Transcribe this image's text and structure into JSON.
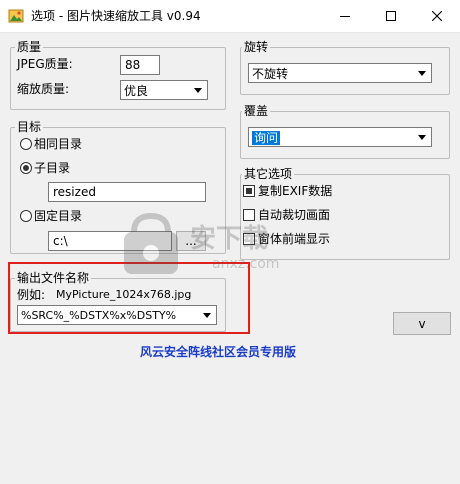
{
  "window": {
    "title": "选项 - 图片快速缩放工具 v0.94"
  },
  "quality": {
    "legend": "质量",
    "jpeg_label": "JPEG质量:",
    "jpeg_value": "88",
    "resample_label": "缩放质量:",
    "resample_value": "优良"
  },
  "target": {
    "legend": "目标",
    "same_dir": "相同目录",
    "sub_dir": "子目录",
    "sub_dir_value": "resized",
    "fixed_dir": "固定目录",
    "fixed_dir_value": "c:\\",
    "browse_label": "..."
  },
  "output": {
    "legend": "输出文件名称",
    "example_label": "例如:",
    "example_value": "MyPicture_1024x768.jpg",
    "pattern_value": "%SRC%_%DSTX%x%DSTY%"
  },
  "rotate": {
    "legend": "旋转",
    "value": "不旋转"
  },
  "overwrite": {
    "legend": "覆盖",
    "value": "询问"
  },
  "other": {
    "legend": "其它选项",
    "copy_exif": "复制EXIF数据",
    "auto_crop": "自动裁切画面",
    "topmost": "窗体前端显示"
  },
  "footer_text": "风云安全阵线社区会员专用版",
  "collapse_button": "v",
  "watermark": {
    "brand": "安下载",
    "domain": "anxz.com"
  },
  "colors": {
    "highlight": "#e0201c",
    "selection": "#0078d7",
    "footer": "#1a3cc8"
  }
}
